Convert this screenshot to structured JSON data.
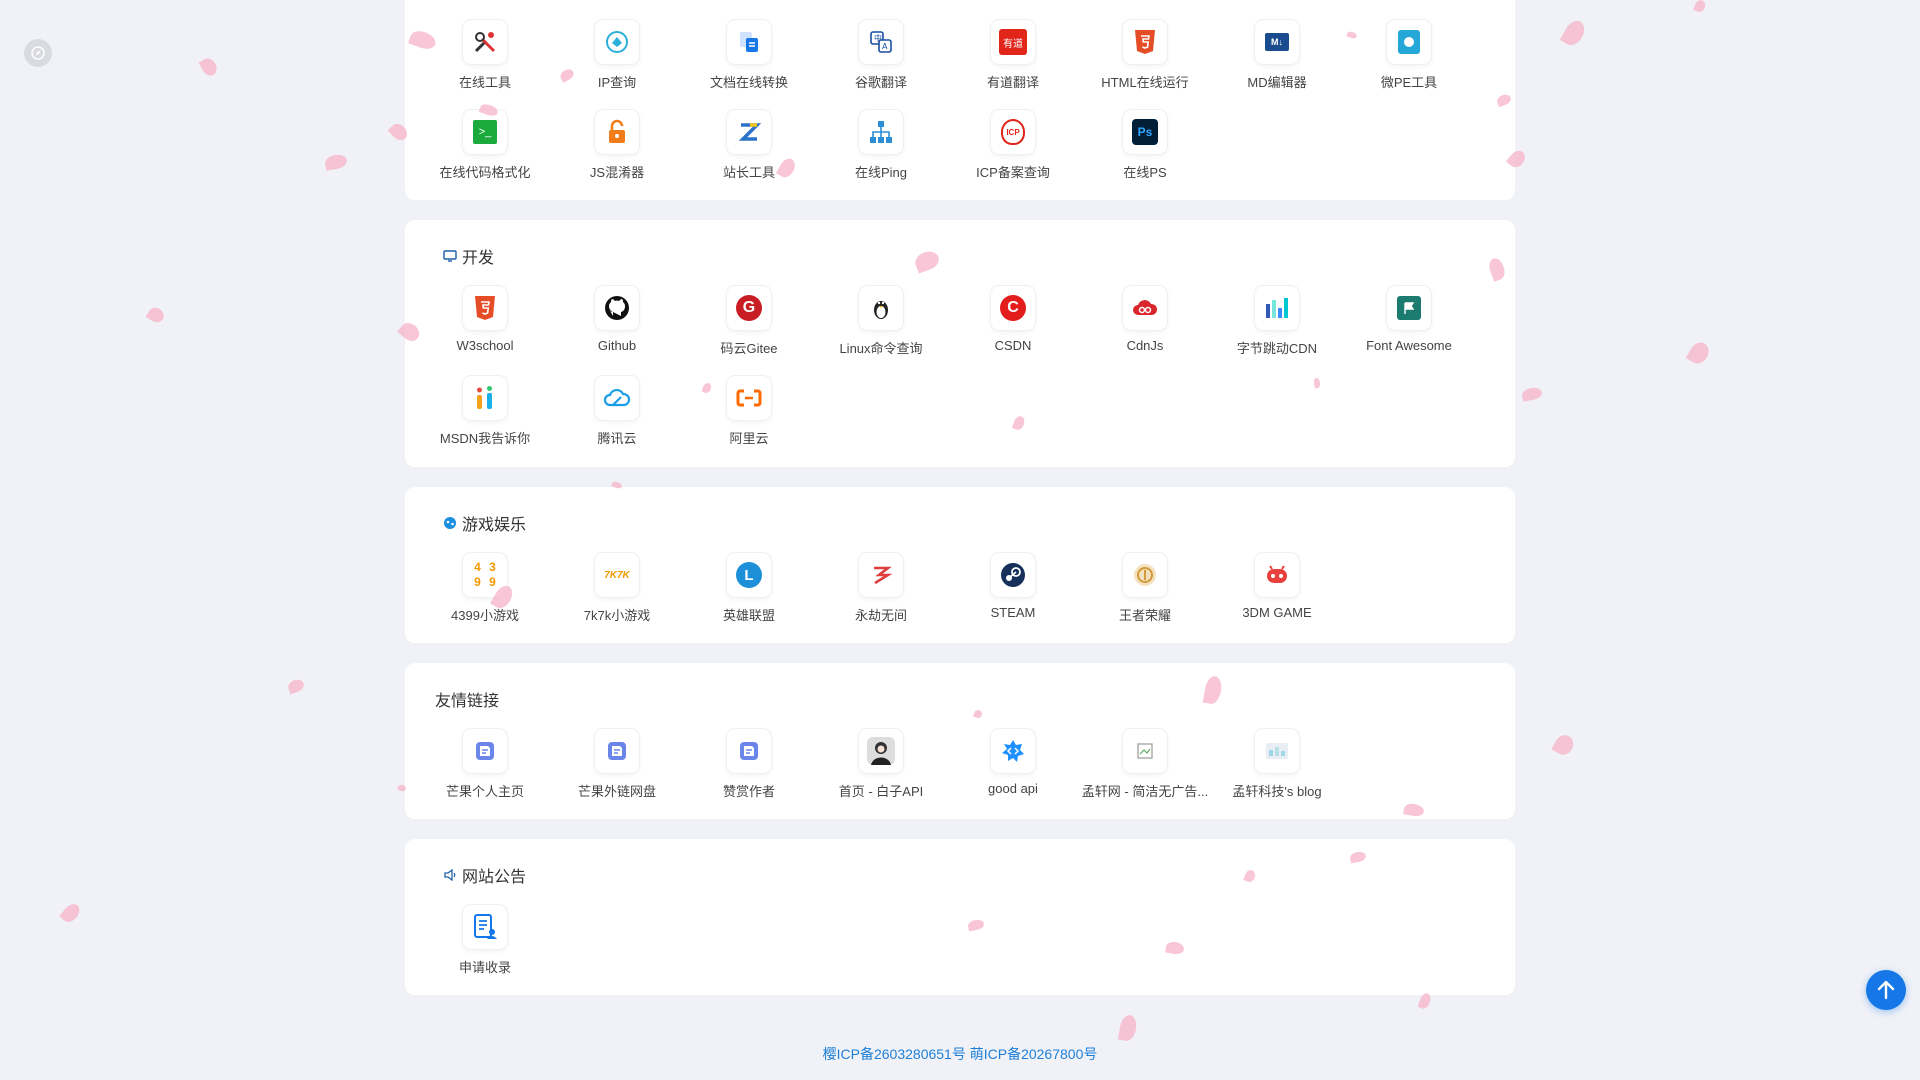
{
  "sections": [
    {
      "title": "",
      "items": [
        {
          "label": "在线工具",
          "icon": "tools-icon"
        },
        {
          "label": "IP查询",
          "icon": "ip-icon"
        },
        {
          "label": "文档在线转换",
          "icon": "doc-convert-icon"
        },
        {
          "label": "谷歌翻译",
          "icon": "translate-icon"
        },
        {
          "label": "有道翻译",
          "icon": "youdao-icon",
          "badge": "有道"
        },
        {
          "label": "HTML在线运行",
          "icon": "html5-icon"
        },
        {
          "label": "MD编辑器",
          "icon": "markdown-icon"
        },
        {
          "label": "微PE工具",
          "icon": "wepe-icon"
        },
        {
          "label": "在线代码格式化",
          "icon": "terminal-icon"
        },
        {
          "label": "JS混淆器",
          "icon": "lock-icon"
        },
        {
          "label": "站长工具",
          "icon": "zhanzhang-icon"
        },
        {
          "label": "在线Ping",
          "icon": "network-icon"
        },
        {
          "label": "ICP备案查询",
          "icon": "icp-icon",
          "badge": "ICP"
        },
        {
          "label": "在线PS",
          "icon": "photoshop-icon",
          "badge": "Ps"
        }
      ]
    },
    {
      "title": "开发",
      "title_icon": "monitor-icon",
      "items": [
        {
          "label": "W3school",
          "icon": "html5-icon"
        },
        {
          "label": "Github",
          "icon": "github-icon"
        },
        {
          "label": "码云Gitee",
          "icon": "gitee-icon"
        },
        {
          "label": "Linux命令查询",
          "icon": "linux-icon"
        },
        {
          "label": "CSDN",
          "icon": "csdn-icon"
        },
        {
          "label": "CdnJs",
          "icon": "cdnjs-icon"
        },
        {
          "label": "字节跳动CDN",
          "icon": "bytedance-icon"
        },
        {
          "label": "Font Awesome",
          "icon": "fontawesome-icon"
        },
        {
          "label": "MSDN我告诉你",
          "icon": "msdn-icon"
        },
        {
          "label": "腾讯云",
          "icon": "tencent-cloud-icon"
        },
        {
          "label": "阿里云",
          "icon": "aliyun-icon"
        }
      ]
    },
    {
      "title": "游戏娱乐",
      "title_icon": "game-icon",
      "items": [
        {
          "label": "4399小游戏",
          "icon": "4399-icon"
        },
        {
          "label": "7k7k小游戏",
          "icon": "7k7k-icon",
          "badge": "7K7K"
        },
        {
          "label": "英雄联盟",
          "icon": "lol-icon"
        },
        {
          "label": "永劫无间",
          "icon": "naraka-icon"
        },
        {
          "label": "STEAM",
          "icon": "steam-icon"
        },
        {
          "label": "王者荣耀",
          "icon": "honor-of-kings-icon"
        },
        {
          "label": "3DM GAME",
          "icon": "3dm-icon"
        }
      ]
    },
    {
      "title": "友情链接",
      "items": [
        {
          "label": "芒果个人主页",
          "icon": "bookmark-icon"
        },
        {
          "label": "芒果外链网盘",
          "icon": "bookmark-icon"
        },
        {
          "label": "赞赏作者",
          "icon": "bookmark-icon"
        },
        {
          "label": "首页 - 白子API",
          "icon": "avatar-icon"
        },
        {
          "label": "good api",
          "icon": "goodapi-icon"
        },
        {
          "label": "孟轩网 - 简洁无广告...",
          "icon": "broken-image-icon"
        },
        {
          "label": "孟轩科技's blog",
          "icon": "blog-icon"
        }
      ]
    },
    {
      "title": "网站公告",
      "title_icon": "speaker-icon",
      "items": [
        {
          "label": "申请收录",
          "icon": "apply-icon"
        }
      ]
    }
  ],
  "footer": "樱ICP备2603280651号 萌ICP备20267800号",
  "colors": {
    "accent": "#1677e8",
    "page_bg": "#f1f2f7",
    "petal": "#f6b3c8"
  }
}
